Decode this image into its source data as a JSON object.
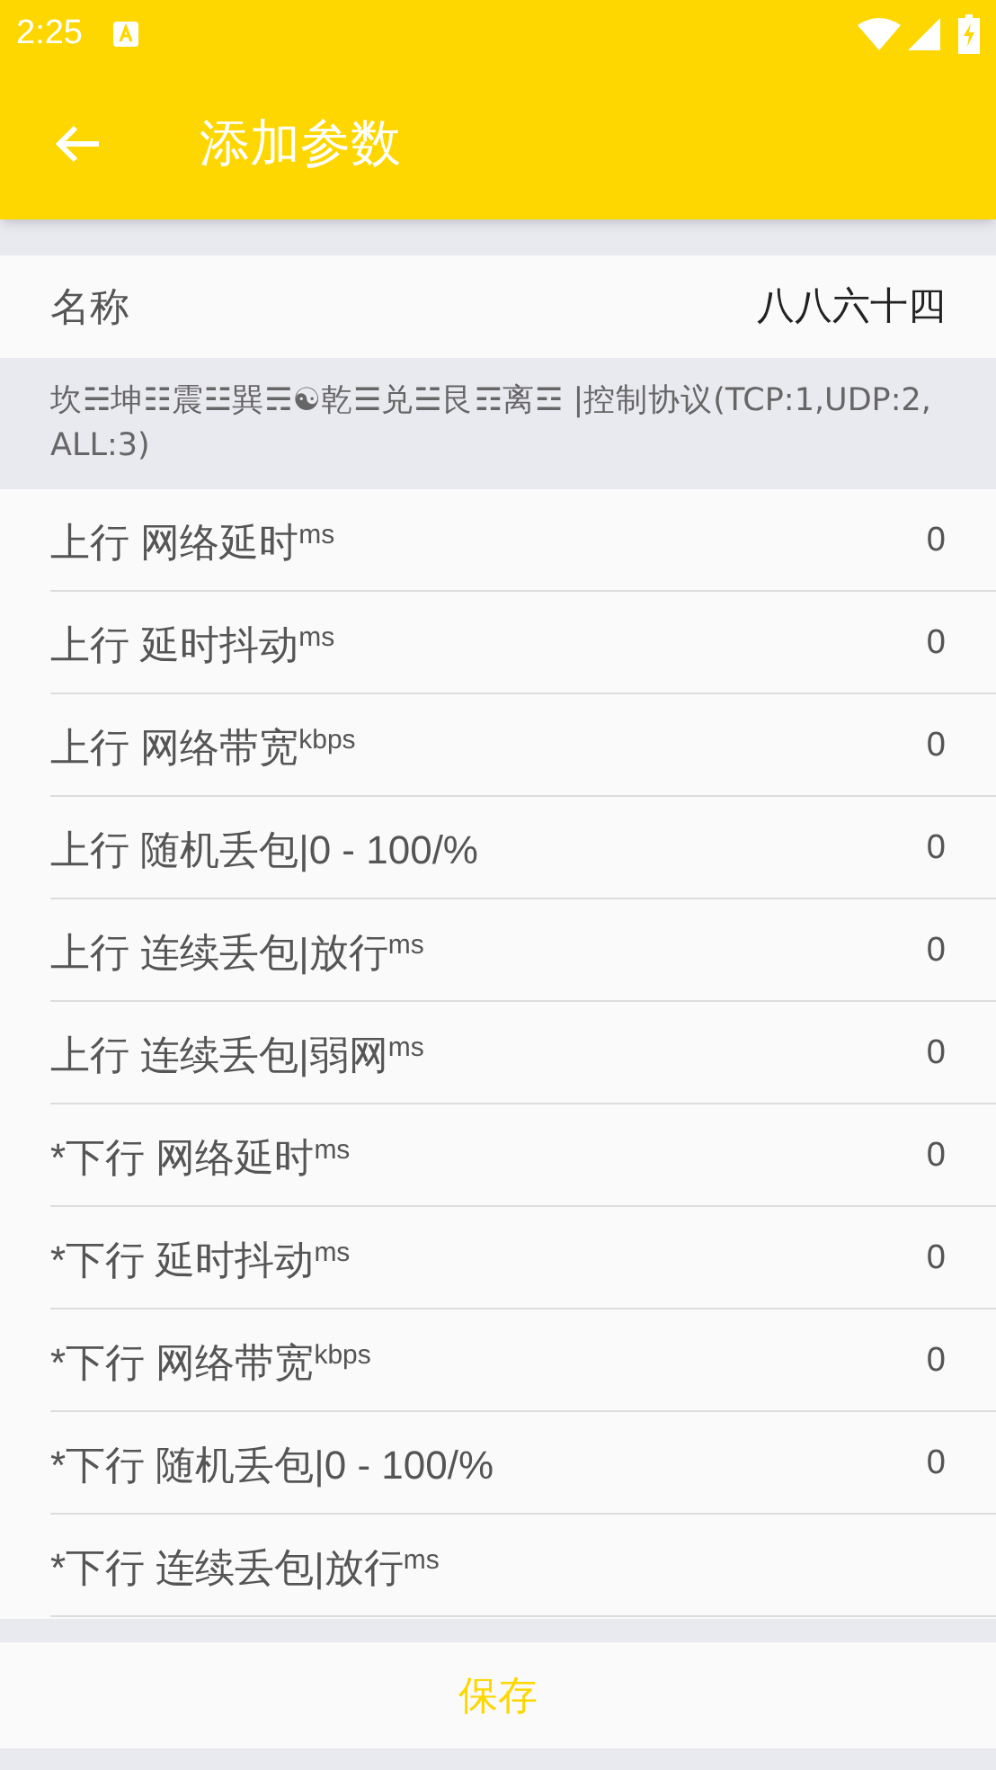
{
  "status_bar": {
    "time": "2:25"
  },
  "app_bar": {
    "title": "添加参数"
  },
  "name_row": {
    "label": "名称",
    "value": "八八六十四"
  },
  "info": "坎☵坤☷震☳巽☴☯乾☰兑☱艮☶离☲ |控制协议(TCP:1,UDP:2,ALL:3)",
  "params": [
    {
      "label": "上行 网络延时$^{ms}$",
      "value": "0"
    },
    {
      "label": "上行 延时抖动$^{ms}$",
      "value": "0"
    },
    {
      "label": "上行 网络带宽$^{kbps}$",
      "value": "0"
    },
    {
      "label": "上行 随机丢包|0 - 100/%",
      "value": "0"
    },
    {
      "label": "上行 连续丢包|放行$^{ms}$",
      "value": "0"
    },
    {
      "label": "上行 连续丢包|弱网$^{ms}$",
      "value": "0"
    },
    {
      "label": "*下行 网络延时$^{ms}$",
      "value": "0"
    },
    {
      "label": "*下行 延时抖动$^{ms}$",
      "value": "0"
    },
    {
      "label": "*下行 网络带宽$^{kbps}$",
      "value": "0"
    },
    {
      "label": "*下行 随机丢包|0 - 100/%",
      "value": "0"
    },
    {
      "label": "*下行 连续丢包|放行$^{ms}$"
    }
  ],
  "save_button": "保存"
}
